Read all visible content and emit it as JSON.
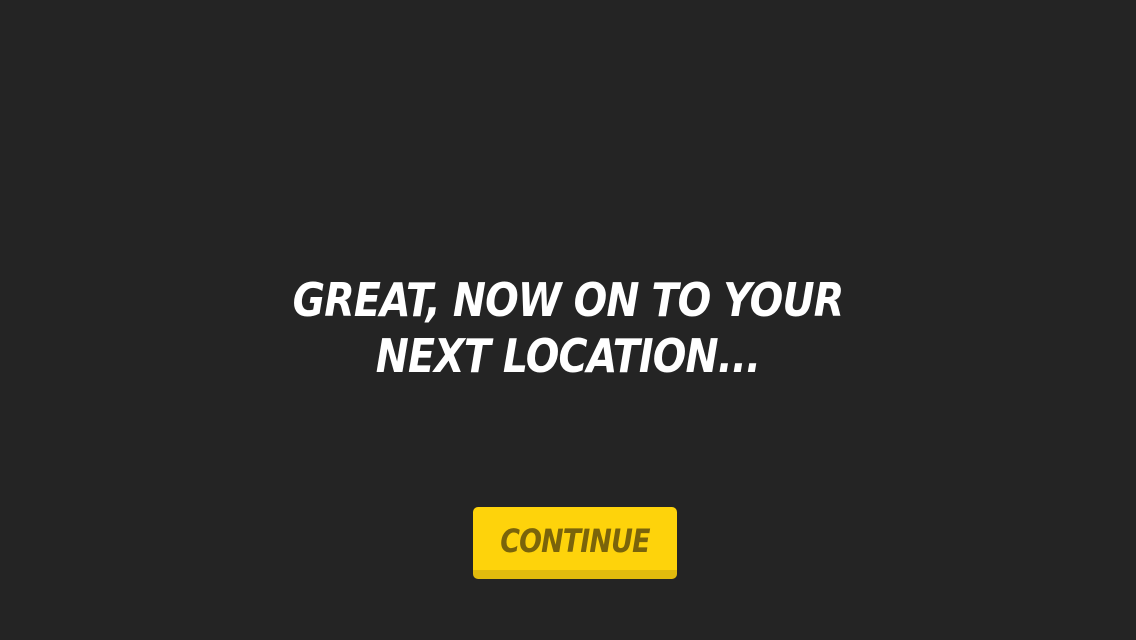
{
  "message": {
    "line1": "GREAT, NOW ON TO YOUR",
    "line2": "NEXT LOCATION..."
  },
  "button": {
    "label": "CONTINUE"
  },
  "colors": {
    "background": "#242424",
    "text": "#ffffff",
    "button": "#fed30b",
    "button_shadow": "#e2bb0d",
    "button_text": "#7a640b"
  }
}
